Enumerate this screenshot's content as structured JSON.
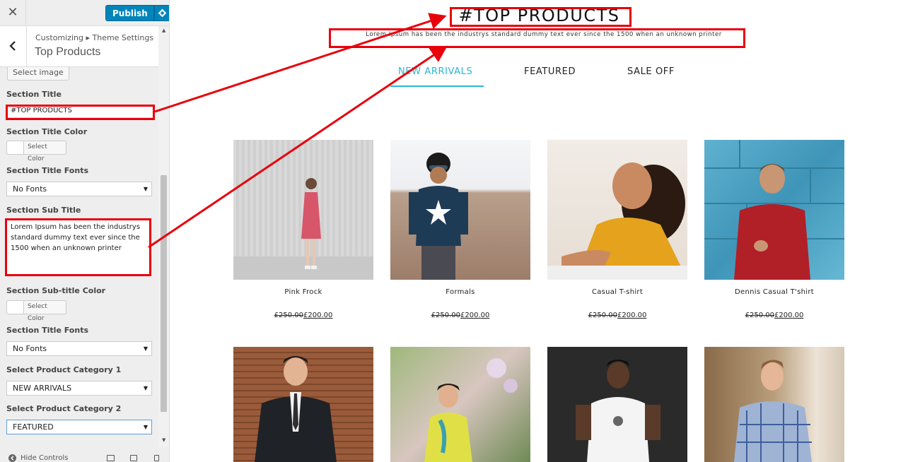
{
  "topbar": {
    "close_glyph": "✕",
    "publish_label": "Publish"
  },
  "section_header": {
    "breadcrumb": "Customizing ▸ Theme Settings",
    "title": "Top Products"
  },
  "controls": {
    "select_image_label": "Select image",
    "section_title_label": "Section Title",
    "section_title_value": "#TOP PRODUCTS",
    "title_color_label": "Section Title Color",
    "select_color_label": "Select Color",
    "title_fonts_label": "Section Title Fonts",
    "title_fonts_value": "No Fonts",
    "sub_title_label": "Section Sub Title",
    "sub_title_value": "Lorem Ipsum has been the industrys standard dummy text ever since the 1500 when an unknown printer",
    "subtitle_color_label": "Section Sub-title Color",
    "subtitle_fonts_label": "Section Title Fonts",
    "subtitle_fonts_value": "No Fonts",
    "category1_label": "Select Product Category 1",
    "category1_value": "NEW ARRIVALS",
    "category2_label": "Select Product Category 2",
    "category2_value": "FEATURED"
  },
  "footer": {
    "hide_controls_label": "Hide Controls"
  },
  "preview": {
    "title": "#TOP PRODUCTS",
    "subtitle": "Lorem Ipsum has been the industrys standard dummy text ever since the 1500 when an unknown printer",
    "tabs": [
      {
        "label": "NEW ARRIVALS",
        "active": true
      },
      {
        "label": "FEATURED",
        "active": false
      },
      {
        "label": "SALE OFF",
        "active": false
      }
    ],
    "products": [
      {
        "name": "Pink Frock",
        "old_price": "£250.00",
        "new_price": "£200.00"
      },
      {
        "name": "Formals",
        "old_price": "£250.00",
        "new_price": "£200.00"
      },
      {
        "name": "Casual T-shirt",
        "old_price": "£250.00",
        "new_price": "£200.00"
      },
      {
        "name": "Dennis Casual T'shirt",
        "old_price": "£250.00",
        "new_price": "£200.00"
      }
    ]
  },
  "colors": {
    "accent": "#29b6d6",
    "publish": "#0085ba",
    "annotation": "#e8000b"
  }
}
